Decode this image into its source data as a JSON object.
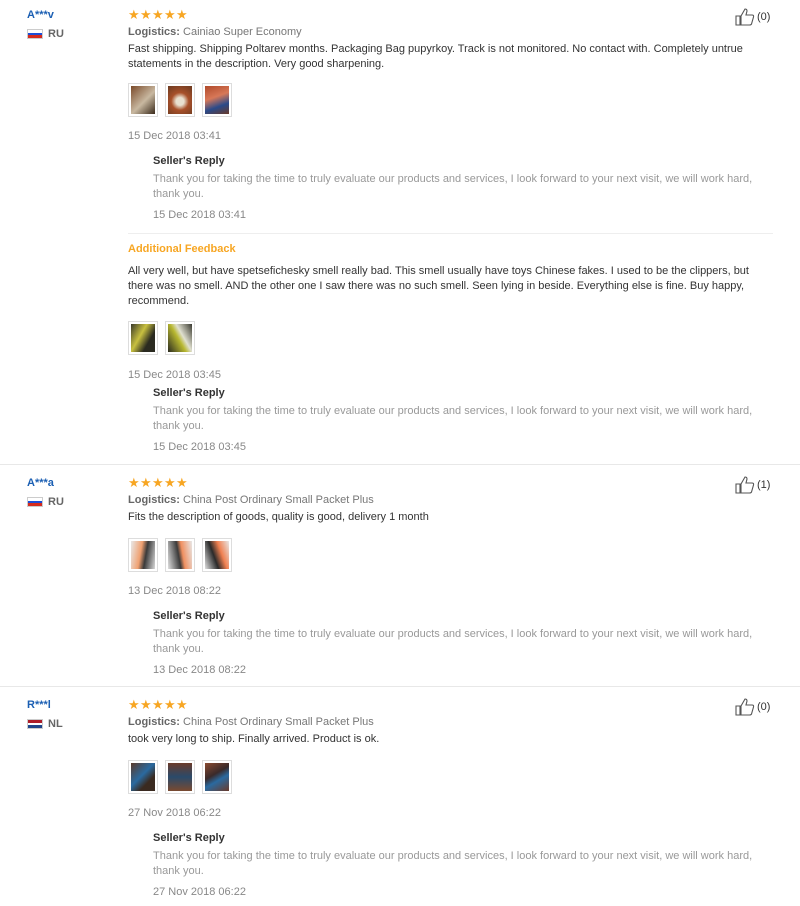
{
  "reviews": [
    {
      "user": "A***v",
      "country": "RU",
      "rating_text": "★★★★★",
      "logistics_label": "Logistics:",
      "logistics_value": "Cainiao Super Economy",
      "text": "Fast shipping. Shipping Poltarev months. Packaging Bag pupyrkoy. Track is not monitored. No contact with. Completely untrue statements in the description. Very good sharpening.",
      "date": "15 Dec 2018 03:41",
      "likes": "(0)",
      "reply_title": "Seller's Reply",
      "reply_text": "Thank you for taking the time to truly evaluate our products and services, I look forward to your next visit, we will work hard, thank you.",
      "reply_date": "15 Dec 2018 03:41",
      "additional": {
        "title": "Additional Feedback",
        "text": "All very well, but have spetsefichesky smell really bad. This smell usually have toys Chinese fakes. I used to be the clippers, but there was no smell. AND the other one I saw there was no such smell. Seen lying in beside. Everything else is fine. Buy happy, recommend.",
        "date": "15 Dec 2018 03:45",
        "reply_title": "Seller's Reply",
        "reply_text": "Thank you for taking the time to truly evaluate our products and services, I look forward to your next visit, we will work hard, thank you.",
        "reply_date": "15 Dec 2018 03:45"
      }
    },
    {
      "user": "A***a",
      "country": "RU",
      "rating_text": "★★★★★",
      "logistics_label": "Logistics:",
      "logistics_value": "China Post Ordinary Small Packet Plus",
      "text": "Fits the description of goods, quality is good, delivery 1 month",
      "date": "13 Dec 2018 08:22",
      "likes": "(1)",
      "reply_title": "Seller's Reply",
      "reply_text": "Thank you for taking the time to truly evaluate our products and services, I look forward to your next visit, we will work hard, thank you.",
      "reply_date": "13 Dec 2018 08:22"
    },
    {
      "user": "R***l",
      "country": "NL",
      "rating_text": "★★★★★",
      "logistics_label": "Logistics:",
      "logistics_value": "China Post Ordinary Small Packet Plus",
      "text": "took very long to ship. Finally arrived. Product is ok.",
      "date": "27 Nov 2018 06:22",
      "likes": "(0)",
      "reply_title": "Seller's Reply",
      "reply_text": "Thank you for taking the time to truly evaluate our products and services, I look forward to your next visit, we will work hard, thank you.",
      "reply_date": "27 Nov 2018 06:22"
    }
  ],
  "colors": {
    "star": "#f7a623",
    "user_link": "#1b5fb3",
    "additional_title": "#f7a623",
    "muted_text": "#999999"
  },
  "icons": {
    "like": "thumbs-up-icon",
    "star": "star-icon",
    "flag_ru": "russia-flag-icon",
    "flag_nl": "netherlands-flag-icon"
  }
}
